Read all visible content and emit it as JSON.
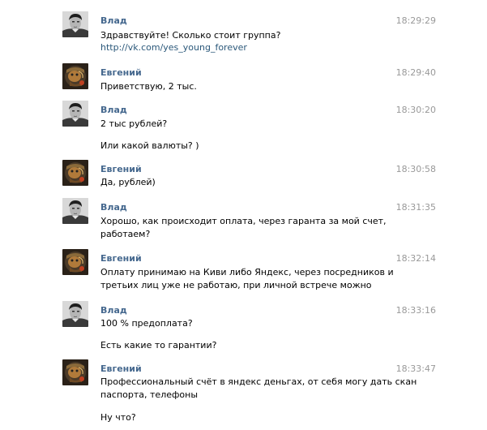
{
  "colors": {
    "author": "#45688e",
    "link": "#2b587a",
    "time": "#999999",
    "text": "#000000"
  },
  "messages": [
    {
      "author": "Влад",
      "time": "18:29:29",
      "avatar": "vlad-avatar",
      "lines": [
        "Здравствуйте! Сколько стоит группа?"
      ],
      "link": "http://vk.com/yes_young_forever"
    },
    {
      "author": "Евгений",
      "time": "18:29:40",
      "avatar": "evgeny-avatar",
      "lines": [
        "Приветствую, 2 тыс."
      ]
    },
    {
      "author": "Влад",
      "time": "18:30:20",
      "avatar": "vlad-avatar",
      "lines": [
        "2 тыс рублей?",
        "Или какой валюты? )"
      ]
    },
    {
      "author": "Евгений",
      "time": "18:30:58",
      "avatar": "evgeny-avatar",
      "lines": [
        "Да, рублей)"
      ]
    },
    {
      "author": "Влад",
      "time": "18:31:35",
      "avatar": "vlad-avatar",
      "lines": [
        "Хорошо, как происходит оплата, через гаранта за мой счет,",
        "работаем?"
      ]
    },
    {
      "author": "Евгений",
      "time": "18:32:14",
      "avatar": "evgeny-avatar",
      "lines": [
        "Оплату принимаю на Киви либо Яндекс, через посредников и",
        "третьих лиц уже не работаю, при личной встрече можно"
      ]
    },
    {
      "author": "Влад",
      "time": "18:33:16",
      "avatar": "vlad-avatar",
      "lines": [
        "100 % предоплата?",
        "Есть какие то гарантии?"
      ]
    },
    {
      "author": "Евгений",
      "time": "18:33:47",
      "avatar": "evgeny-avatar",
      "lines": [
        "Профессиональный счёт в яндекс деньгах, от себя могу дать скан",
        "паспорта, телефоны",
        "Ну что?"
      ]
    }
  ]
}
